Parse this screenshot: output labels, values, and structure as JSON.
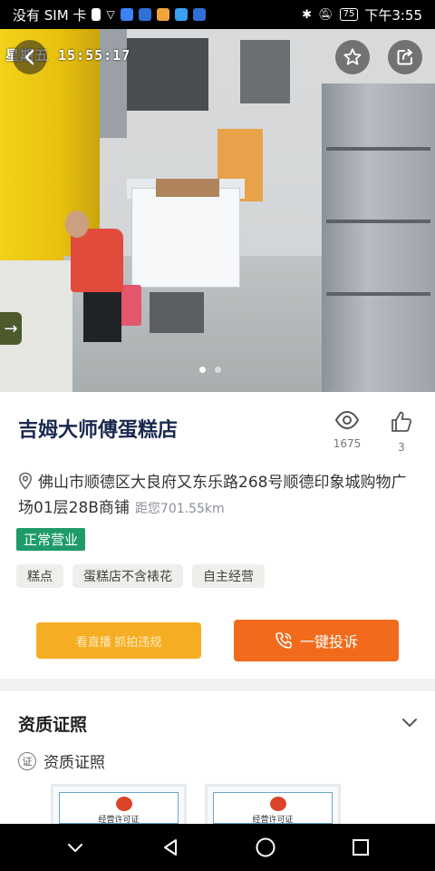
{
  "status_bar": {
    "carrier": "没有 SIM 卡",
    "battery": "75",
    "time": "下午3:55"
  },
  "camera": {
    "timestamp": "星期五 15:55:17",
    "slides": 2,
    "active_slide": 1
  },
  "store": {
    "name": "吉姆大师傅蛋糕店",
    "views": "1675",
    "likes": "3",
    "address": "佛山市顺德区大良府又东乐路268号顺德印象城购物广场01层28B商铺",
    "distance": "距您701.55km",
    "status": "正常营业",
    "tags": [
      "糕点",
      "蛋糕店不含裱花",
      "自主经营"
    ]
  },
  "actions": {
    "live_label": "看直播 抓拍违规",
    "complain_label": "一键投诉"
  },
  "qualification": {
    "section_title": "资质证照",
    "badge": "证",
    "subtitle": "资质证照",
    "certificates": [
      {
        "title": "经营许可证"
      },
      {
        "title": "经营许可证"
      }
    ]
  },
  "colors": {
    "accent_orange": "#f26a1b",
    "live_yellow": "#f5ae23",
    "status_green": "#1f9b6a",
    "title_navy": "#1b2950"
  },
  "icons": {
    "back": "chevron-left-icon",
    "favorite": "star-icon",
    "share": "share-icon",
    "views": "eye-icon",
    "likes": "thumbs-up-icon",
    "location": "location-pin-icon",
    "phone": "phone-icon"
  }
}
